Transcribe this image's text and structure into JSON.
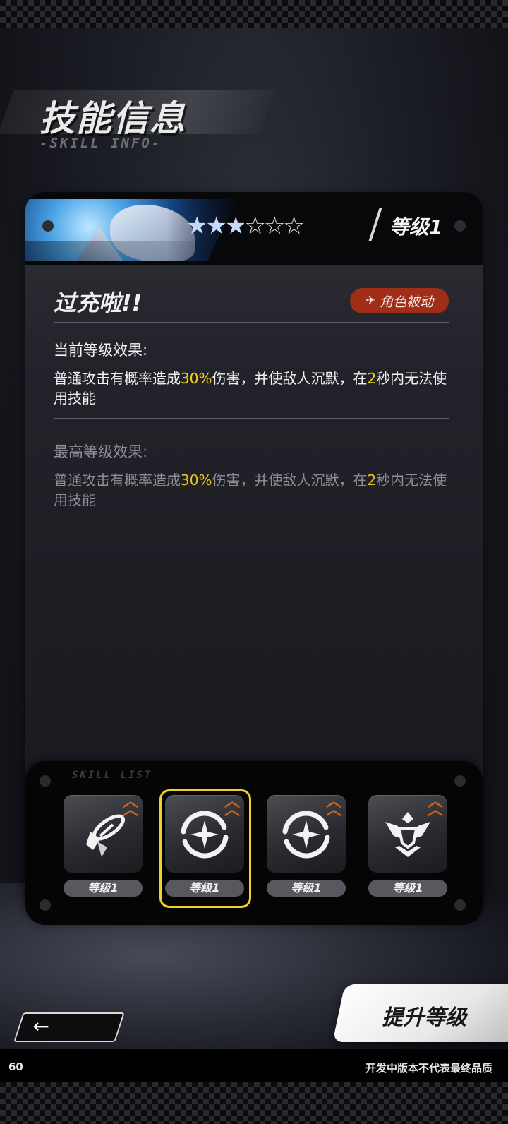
{
  "header": {
    "title": "技能信息",
    "subtitle": "-SKILL INFO-"
  },
  "skill": {
    "stars_filled": 3,
    "stars_total": 6,
    "level_label": "等级1",
    "name": "过充啦!!",
    "type_badge": "角色被动",
    "type_icon": "pinwheel-icon"
  },
  "current_effect": {
    "title": "当前等级效果:",
    "desc_part1": "普通攻击有概率造成",
    "highlight1": "30%",
    "desc_part2": "伤害，并使敌人沉默，在",
    "highlight2": "2",
    "desc_part3": "秒内无法使用技能"
  },
  "max_effect": {
    "title": "最高等级效果:",
    "desc_part1": "普通攻击有概率造成",
    "highlight1": "30%",
    "desc_part2": "伤害，并使敌人沉默，在",
    "highlight2": "2",
    "desc_part3": "秒内无法使用技能"
  },
  "skill_list": {
    "tag": "SKILL LIST",
    "slots": [
      {
        "icon": "satellite-dish-icon",
        "level": "等级1",
        "selected": false
      },
      {
        "icon": "orbit-star-icon",
        "level": "等级1",
        "selected": true
      },
      {
        "icon": "orbit-star-icon",
        "level": "等级1",
        "selected": false
      },
      {
        "icon": "crest-emblem-icon",
        "level": "等级1",
        "selected": false
      }
    ]
  },
  "controls": {
    "back_icon": "←",
    "upgrade_label": "提升等级"
  },
  "footer": {
    "fps": "60",
    "disclaimer": "开发中版本不代表最终品质"
  },
  "colors": {
    "highlight": "#f3d11e",
    "badge": "#a02d18",
    "selected_outline": "#f0d225",
    "upgrade_chevron": "#d2661f"
  }
}
